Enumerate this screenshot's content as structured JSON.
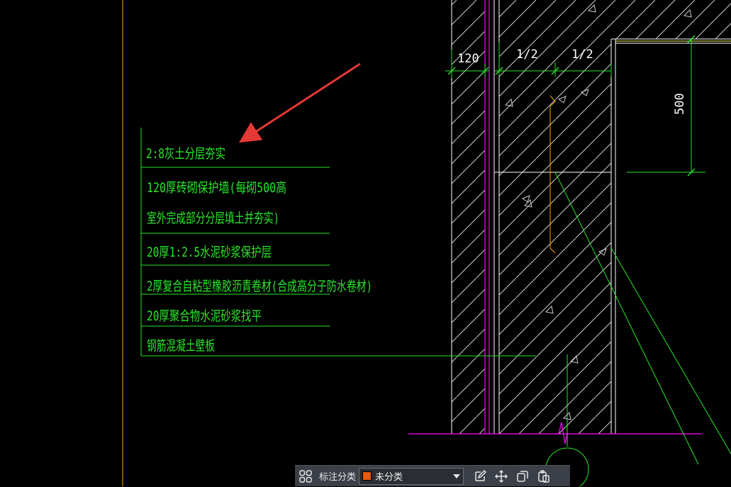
{
  "drawing": {
    "layers": [
      "2:8灰土分层夯实",
      "120厚砖砌保护墙(每砌500高",
      "室外完成部分分层填土并夯实)",
      "20厚1:2.5水泥砂浆保护层",
      "2厚复合自粘型橡胶沥青卷材(合成高分子防水卷材)",
      "20厚聚合物水泥砂浆找平",
      "钢筋混凝土壁板"
    ],
    "dimensions": {
      "brick_wall": "120",
      "half_left": "1/2",
      "half_right": "1/2",
      "height": "500"
    }
  },
  "toolbar": {
    "category_label": "标注分类",
    "category_value": "未分类",
    "category_color": "#e85a0c"
  },
  "colors": {
    "leader": "#28e628",
    "hatch": "#ffffff",
    "wall_line": "#ff00ff",
    "frame": "#ffa500",
    "arrow": "#e53935"
  }
}
